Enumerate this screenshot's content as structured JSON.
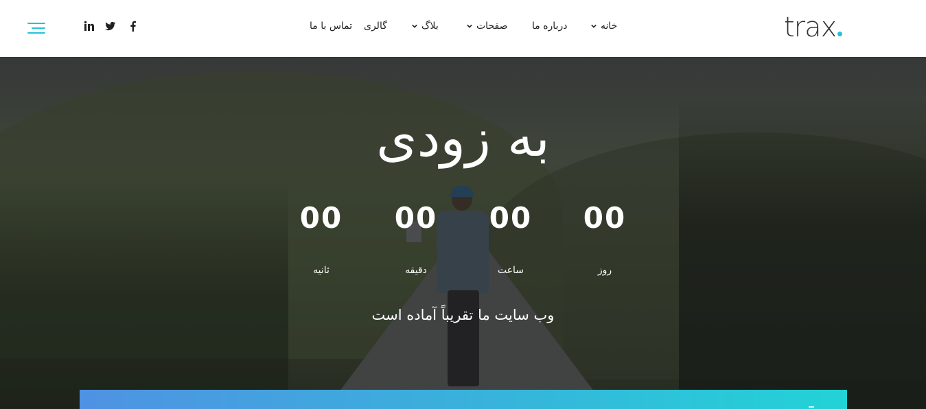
{
  "brand": {
    "logo_text": "trax",
    "accent": "#22c3d6"
  },
  "nav": {
    "items": [
      {
        "label": "خانه",
        "dropdown": true
      },
      {
        "label": "درباره ما",
        "dropdown": false
      },
      {
        "label": "صفحات",
        "dropdown": true
      },
      {
        "label": "بلاگ",
        "dropdown": true
      },
      {
        "label": "گالری",
        "dropdown": false
      },
      {
        "label": "تماس با ما",
        "dropdown": false
      }
    ]
  },
  "socials": [
    {
      "icon": "facebook-icon"
    },
    {
      "icon": "twitter-icon"
    },
    {
      "icon": "linkedin-icon"
    }
  ],
  "menu_button": {
    "icon": "menu-icon"
  },
  "hero": {
    "title": "به زودی",
    "countdown": [
      {
        "value": "00",
        "label": "روز"
      },
      {
        "value": "00",
        "label": "ساعت"
      },
      {
        "value": "00",
        "label": "دقیقه"
      },
      {
        "value": "00",
        "label": "ثانیه"
      }
    ],
    "subtitle": "وب سایت ما تقریباً آماده است"
  },
  "band": {
    "gradient_start": "#4f92e3",
    "gradient_end": "#22d3d7"
  }
}
